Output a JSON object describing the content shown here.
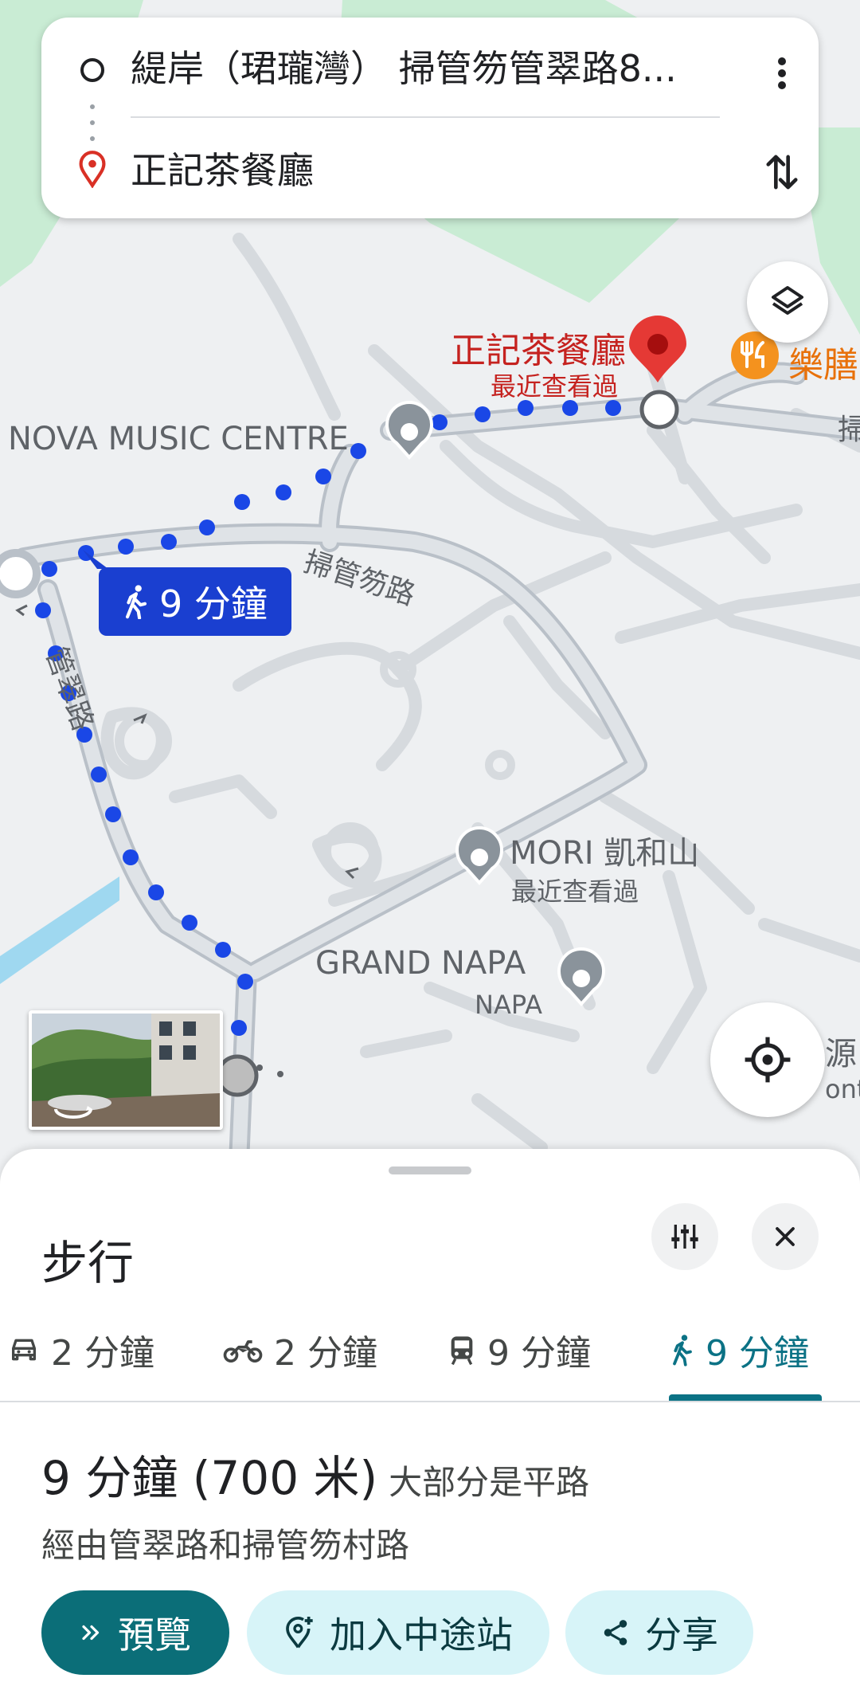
{
  "route": {
    "origin": "緹岸（珺瓏灣） 掃管笏管翠路8...",
    "destination": "正記茶餐廳"
  },
  "map": {
    "dest_pin_label": "正記茶餐廳",
    "dest_pin_sub": "最近查看過",
    "restaurant_label": "樂膳",
    "nova_label": "NOVA MUSIC CENTRE",
    "road_saoguanfu": "掃管笏路",
    "road_guancui": "管翠路",
    "walk_badge": "9 分鐘",
    "mori_label": "MORI 凱和山",
    "mori_sub": "最近查看過",
    "napa_label": "GRAND NAPA",
    "napa_sub": "NAPA",
    "edge_label_1": "源",
    "edge_label_2": "ont",
    "edge_label_3": "掃"
  },
  "sheet": {
    "title": "步行",
    "tabs": [
      {
        "label": "2 分鐘",
        "icon": "car-icon"
      },
      {
        "label": "2 分鐘",
        "icon": "motorcycle-icon"
      },
      {
        "label": "9 分鐘",
        "icon": "transit-icon"
      },
      {
        "label": "9 分鐘",
        "icon": "walk-icon",
        "active": true
      }
    ],
    "summary_main": "9 分鐘 (700 米)",
    "summary_sub": "大部分是平路",
    "via": "經由管翠路和掃管笏村路",
    "buttons": {
      "preview": "預覽",
      "add_stop": "加入中途站",
      "share": "分享"
    }
  },
  "colors": {
    "route_dot": "#1a47e6",
    "accent_teal": "#0b6e78",
    "dest_pin": "#d93025",
    "restaurant": "#e8710a"
  }
}
